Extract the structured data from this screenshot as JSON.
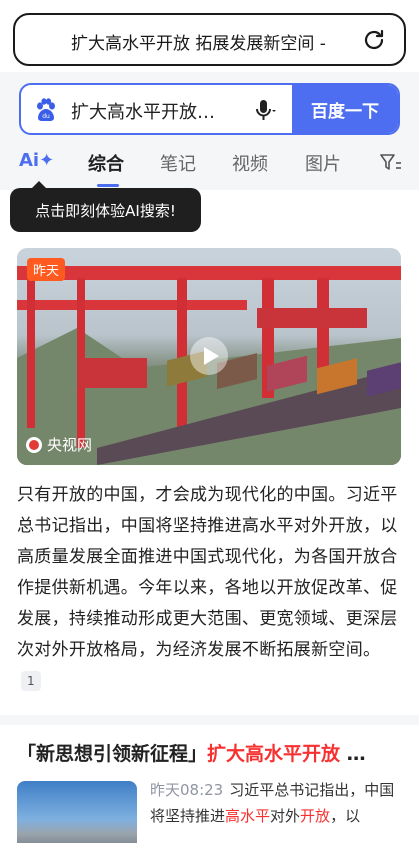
{
  "urlbar": {
    "text": "扩大高水平开放 拓展发展新空间 -"
  },
  "search": {
    "query": "扩大高水平开放…",
    "button": "百度一下"
  },
  "tabs": {
    "ai_label": "Ai",
    "items": [
      {
        "label": "综合"
      },
      {
        "label": "笔记"
      },
      {
        "label": "视频"
      },
      {
        "label": "图片"
      }
    ]
  },
  "tooltip": {
    "text": "点击即刻体验AI搜索!"
  },
  "video": {
    "badge": "昨天",
    "source": "央视网"
  },
  "summary": {
    "text": "只有开放的中国，才会成为现代化的中国。习近平总书记指出，中国将坚持推进高水平对外开放，以高质量发展全面推进中国式现代化，为各国开放合作提供新机遇。今年以来，各地以开放促改革、促发展，持续推动形成更大范围、更宽领域、更深层次对外开放格局，为经济发展不断拓展新空间。",
    "cite": "1"
  },
  "result2": {
    "title_prefix": "「新思想引领新征程」",
    "title_highlight": "扩大高水平开放",
    "title_suffix": " …",
    "time": "昨天08:23",
    "text_a": "习近平总书记指出，中国将坚持推进",
    "text_hl1": "高水平",
    "text_b": "对外",
    "text_hl2": "开放",
    "text_c": "，以"
  },
  "colors": {
    "accent": "#4e6ef2",
    "highlight": "#f73131",
    "badge": "#ff5a1f"
  }
}
